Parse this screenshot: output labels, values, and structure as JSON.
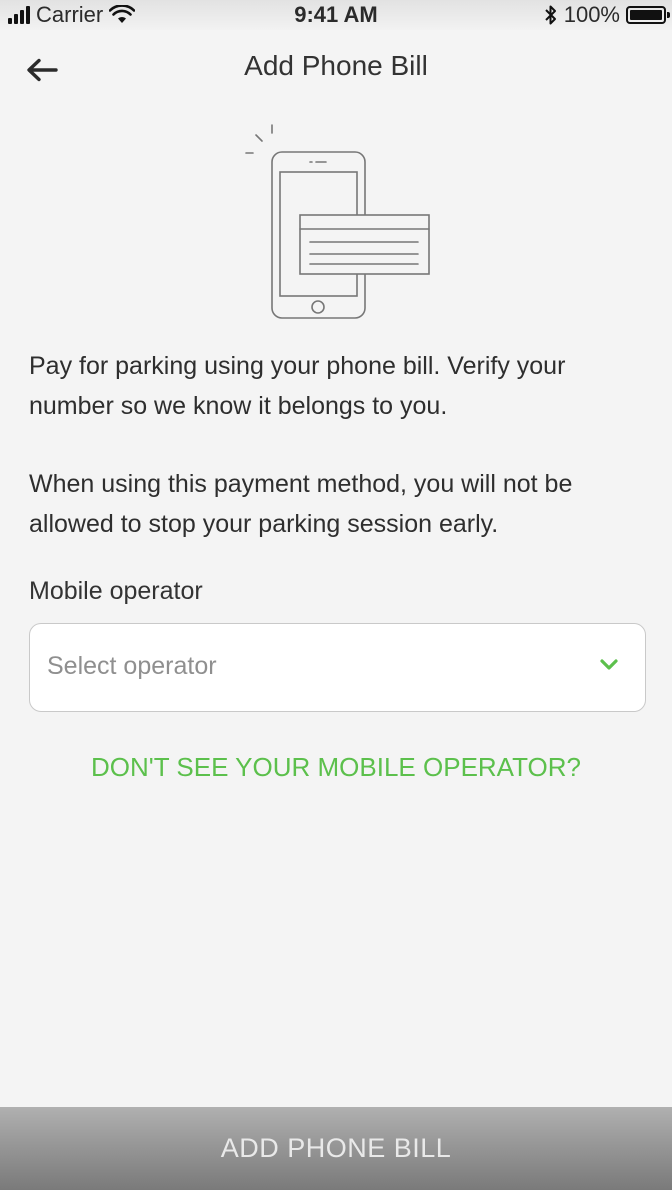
{
  "status_bar": {
    "carrier": "Carrier",
    "time": "9:41 AM",
    "battery_text": "100%",
    "battery_level": 1.0
  },
  "nav": {
    "back_icon": "arrow-left-icon",
    "title": "Add Phone Bill"
  },
  "illustration": {
    "icon": "phone-bill-illustration"
  },
  "content": {
    "paragraph1": "Pay for parking using your phone bill. Verify your number so we know it belongs to you.",
    "paragraph2": "When using this payment method, you will not be allowed to stop your parking session early."
  },
  "form": {
    "operator_label": "Mobile operator",
    "operator_placeholder": "Select operator",
    "chevron_icon": "chevron-down-icon"
  },
  "help_link": "DON'T SEE YOUR MOBILE OPERATOR?",
  "footer": {
    "button_label": "ADD PHONE BILL"
  },
  "colors": {
    "accent": "#5cc04c",
    "background": "#f4f4f4",
    "footer_button": "#9a9a9a"
  }
}
